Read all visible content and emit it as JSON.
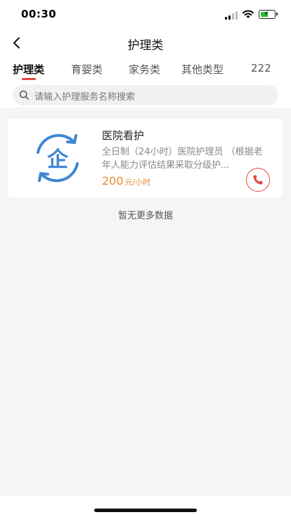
{
  "status_bar": {
    "time": "00:30"
  },
  "nav": {
    "title": "护理类"
  },
  "tabs": [
    {
      "label": "护理类",
      "active": true
    },
    {
      "label": "育婴类",
      "active": false
    },
    {
      "label": "家务类",
      "active": false
    },
    {
      "label": "其他类型",
      "active": false
    },
    {
      "label": "222",
      "active": false
    }
  ],
  "search": {
    "placeholder": "请输入护理服务名称搜索"
  },
  "services": [
    {
      "title": "医院看护",
      "description": "全日制（24小时）医院护理员 （根据老年人能力评估结果采取分级护...",
      "price": "200",
      "unit": "元/小时",
      "logo_icon": "enterprise-logo-icon",
      "logo_text": "企"
    }
  ],
  "footer": {
    "no_more_text": "暂无更多数据"
  },
  "colors": {
    "accent": "#e2473f",
    "price": "#e58a31",
    "logo": "#3f86d6"
  }
}
